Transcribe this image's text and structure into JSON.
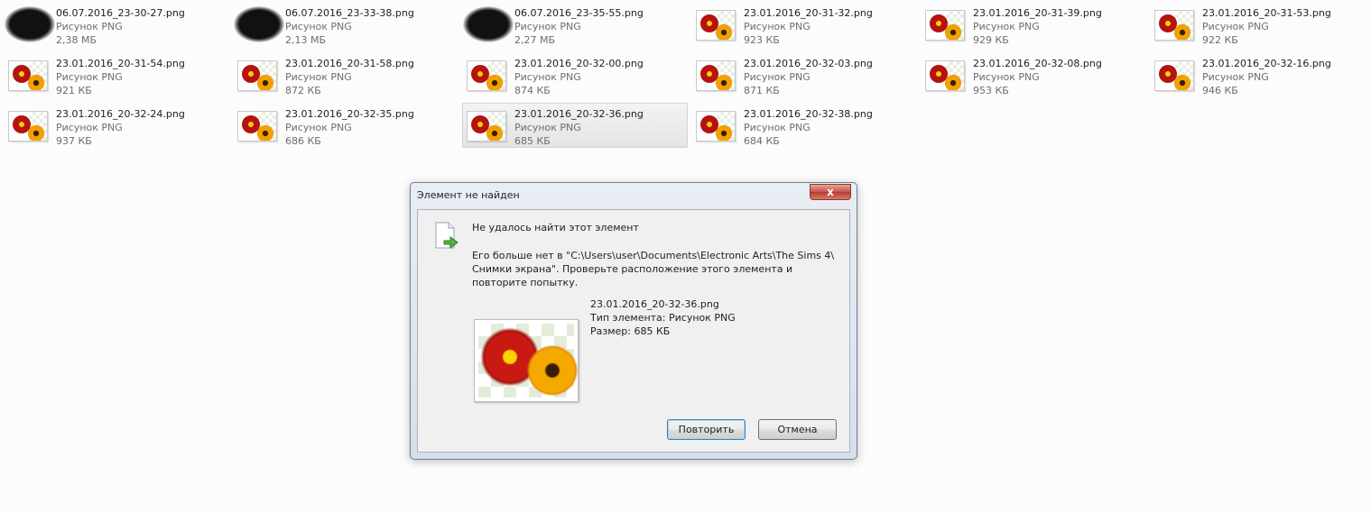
{
  "files": [
    {
      "name": "06.07.2016_23-30-27.png",
      "type": "Рисунок PNG",
      "size": "2,38 МБ",
      "obscured": true
    },
    {
      "name": "06.07.2016_23-33-38.png",
      "type": "Рисунок PNG",
      "size": "2,13 МБ",
      "obscured": true
    },
    {
      "name": "06.07.2016_23-35-55.png",
      "type": "Рисунок PNG",
      "size": "2,27 МБ",
      "obscured": true
    },
    {
      "name": "23.01.2016_20-31-32.png",
      "type": "Рисунок PNG",
      "size": "923 КБ"
    },
    {
      "name": "23.01.2016_20-31-39.png",
      "type": "Рисунок PNG",
      "size": "929 КБ"
    },
    {
      "name": "23.01.2016_20-31-53.png",
      "type": "Рисунок PNG",
      "size": "922 КБ"
    },
    {
      "name": "23.01.2016_20-31-54.png",
      "type": "Рисунок PNG",
      "size": "921 КБ"
    },
    {
      "name": "23.01.2016_20-31-58.png",
      "type": "Рисунок PNG",
      "size": "872 КБ"
    },
    {
      "name": "23.01.2016_20-32-00.png",
      "type": "Рисунок PNG",
      "size": "874 КБ"
    },
    {
      "name": "23.01.2016_20-32-03.png",
      "type": "Рисунок PNG",
      "size": "871 КБ"
    },
    {
      "name": "23.01.2016_20-32-08.png",
      "type": "Рисунок PNG",
      "size": "953 КБ"
    },
    {
      "name": "23.01.2016_20-32-16.png",
      "type": "Рисунок PNG",
      "size": "946 КБ"
    },
    {
      "name": "23.01.2016_20-32-24.png",
      "type": "Рисунок PNG",
      "size": "937 КБ"
    },
    {
      "name": "23.01.2016_20-32-35.png",
      "type": "Рисунок PNG",
      "size": "686 КБ"
    },
    {
      "name": "23.01.2016_20-32-36.png",
      "type": "Рисунок PNG",
      "size": "685 КБ",
      "selected": true
    },
    {
      "name": "23.01.2016_20-32-38.png",
      "type": "Рисунок PNG",
      "size": "684 КБ"
    }
  ],
  "dialog": {
    "title": "Элемент не найден",
    "close_label": "x",
    "message_title": "Не удалось найти этот элемент",
    "message_body": "Его больше нет в \"C:\\Users\\user\\Documents\\Electronic Arts\\The Sims 4\\ Снимки экрана\". Проверьте расположение этого элемента и повторите попытку.",
    "file_name": "23.01.2016_20-32-36.png",
    "file_type": "Тип элемента: Рисунок PNG",
    "file_size": "Размер: 685 КБ",
    "retry_label": "Повторить",
    "cancel_label": "Отмена"
  }
}
